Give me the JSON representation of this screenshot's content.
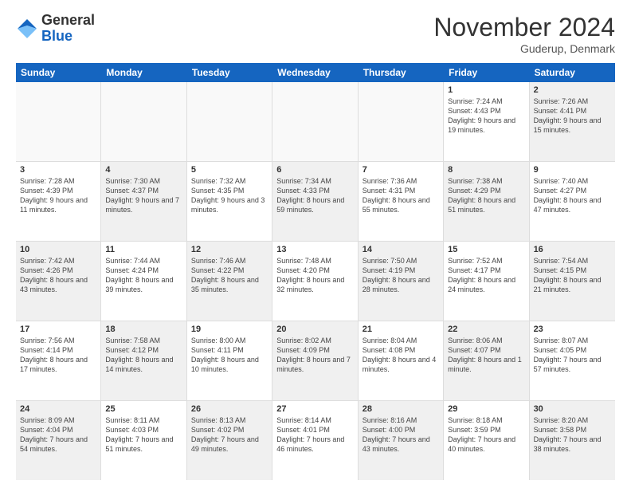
{
  "logo": {
    "line1": "General",
    "line2": "Blue"
  },
  "title": "November 2024",
  "location": "Guderup, Denmark",
  "weekdays": [
    "Sunday",
    "Monday",
    "Tuesday",
    "Wednesday",
    "Thursday",
    "Friday",
    "Saturday"
  ],
  "rows": [
    [
      {
        "day": "",
        "info": "",
        "empty": true
      },
      {
        "day": "",
        "info": "",
        "empty": true
      },
      {
        "day": "",
        "info": "",
        "empty": true
      },
      {
        "day": "",
        "info": "",
        "empty": true
      },
      {
        "day": "",
        "info": "",
        "empty": true
      },
      {
        "day": "1",
        "info": "Sunrise: 7:24 AM\nSunset: 4:43 PM\nDaylight: 9 hours\nand 19 minutes.",
        "empty": false,
        "shaded": false
      },
      {
        "day": "2",
        "info": "Sunrise: 7:26 AM\nSunset: 4:41 PM\nDaylight: 9 hours\nand 15 minutes.",
        "empty": false,
        "shaded": true
      }
    ],
    [
      {
        "day": "3",
        "info": "Sunrise: 7:28 AM\nSunset: 4:39 PM\nDaylight: 9 hours\nand 11 minutes.",
        "empty": false,
        "shaded": false
      },
      {
        "day": "4",
        "info": "Sunrise: 7:30 AM\nSunset: 4:37 PM\nDaylight: 9 hours\nand 7 minutes.",
        "empty": false,
        "shaded": true
      },
      {
        "day": "5",
        "info": "Sunrise: 7:32 AM\nSunset: 4:35 PM\nDaylight: 9 hours\nand 3 minutes.",
        "empty": false,
        "shaded": false
      },
      {
        "day": "6",
        "info": "Sunrise: 7:34 AM\nSunset: 4:33 PM\nDaylight: 8 hours\nand 59 minutes.",
        "empty": false,
        "shaded": true
      },
      {
        "day": "7",
        "info": "Sunrise: 7:36 AM\nSunset: 4:31 PM\nDaylight: 8 hours\nand 55 minutes.",
        "empty": false,
        "shaded": false
      },
      {
        "day": "8",
        "info": "Sunrise: 7:38 AM\nSunset: 4:29 PM\nDaylight: 8 hours\nand 51 minutes.",
        "empty": false,
        "shaded": true
      },
      {
        "day": "9",
        "info": "Sunrise: 7:40 AM\nSunset: 4:27 PM\nDaylight: 8 hours\nand 47 minutes.",
        "empty": false,
        "shaded": false
      }
    ],
    [
      {
        "day": "10",
        "info": "Sunrise: 7:42 AM\nSunset: 4:26 PM\nDaylight: 8 hours\nand 43 minutes.",
        "empty": false,
        "shaded": true
      },
      {
        "day": "11",
        "info": "Sunrise: 7:44 AM\nSunset: 4:24 PM\nDaylight: 8 hours\nand 39 minutes.",
        "empty": false,
        "shaded": false
      },
      {
        "day": "12",
        "info": "Sunrise: 7:46 AM\nSunset: 4:22 PM\nDaylight: 8 hours\nand 35 minutes.",
        "empty": false,
        "shaded": true
      },
      {
        "day": "13",
        "info": "Sunrise: 7:48 AM\nSunset: 4:20 PM\nDaylight: 8 hours\nand 32 minutes.",
        "empty": false,
        "shaded": false
      },
      {
        "day": "14",
        "info": "Sunrise: 7:50 AM\nSunset: 4:19 PM\nDaylight: 8 hours\nand 28 minutes.",
        "empty": false,
        "shaded": true
      },
      {
        "day": "15",
        "info": "Sunrise: 7:52 AM\nSunset: 4:17 PM\nDaylight: 8 hours\nand 24 minutes.",
        "empty": false,
        "shaded": false
      },
      {
        "day": "16",
        "info": "Sunrise: 7:54 AM\nSunset: 4:15 PM\nDaylight: 8 hours\nand 21 minutes.",
        "empty": false,
        "shaded": true
      }
    ],
    [
      {
        "day": "17",
        "info": "Sunrise: 7:56 AM\nSunset: 4:14 PM\nDaylight: 8 hours\nand 17 minutes.",
        "empty": false,
        "shaded": false
      },
      {
        "day": "18",
        "info": "Sunrise: 7:58 AM\nSunset: 4:12 PM\nDaylight: 8 hours\nand 14 minutes.",
        "empty": false,
        "shaded": true
      },
      {
        "day": "19",
        "info": "Sunrise: 8:00 AM\nSunset: 4:11 PM\nDaylight: 8 hours\nand 10 minutes.",
        "empty": false,
        "shaded": false
      },
      {
        "day": "20",
        "info": "Sunrise: 8:02 AM\nSunset: 4:09 PM\nDaylight: 8 hours\nand 7 minutes.",
        "empty": false,
        "shaded": true
      },
      {
        "day": "21",
        "info": "Sunrise: 8:04 AM\nSunset: 4:08 PM\nDaylight: 8 hours\nand 4 minutes.",
        "empty": false,
        "shaded": false
      },
      {
        "day": "22",
        "info": "Sunrise: 8:06 AM\nSunset: 4:07 PM\nDaylight: 8 hours\nand 1 minute.",
        "empty": false,
        "shaded": true
      },
      {
        "day": "23",
        "info": "Sunrise: 8:07 AM\nSunset: 4:05 PM\nDaylight: 7 hours\nand 57 minutes.",
        "empty": false,
        "shaded": false
      }
    ],
    [
      {
        "day": "24",
        "info": "Sunrise: 8:09 AM\nSunset: 4:04 PM\nDaylight: 7 hours\nand 54 minutes.",
        "empty": false,
        "shaded": true
      },
      {
        "day": "25",
        "info": "Sunrise: 8:11 AM\nSunset: 4:03 PM\nDaylight: 7 hours\nand 51 minutes.",
        "empty": false,
        "shaded": false
      },
      {
        "day": "26",
        "info": "Sunrise: 8:13 AM\nSunset: 4:02 PM\nDaylight: 7 hours\nand 49 minutes.",
        "empty": false,
        "shaded": true
      },
      {
        "day": "27",
        "info": "Sunrise: 8:14 AM\nSunset: 4:01 PM\nDaylight: 7 hours\nand 46 minutes.",
        "empty": false,
        "shaded": false
      },
      {
        "day": "28",
        "info": "Sunrise: 8:16 AM\nSunset: 4:00 PM\nDaylight: 7 hours\nand 43 minutes.",
        "empty": false,
        "shaded": true
      },
      {
        "day": "29",
        "info": "Sunrise: 8:18 AM\nSunset: 3:59 PM\nDaylight: 7 hours\nand 40 minutes.",
        "empty": false,
        "shaded": false
      },
      {
        "day": "30",
        "info": "Sunrise: 8:20 AM\nSunset: 3:58 PM\nDaylight: 7 hours\nand 38 minutes.",
        "empty": false,
        "shaded": true
      }
    ]
  ]
}
